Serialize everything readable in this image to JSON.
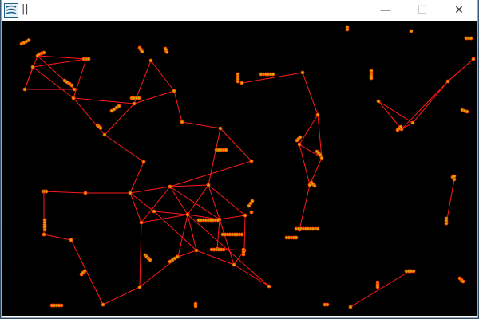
{
  "window": {
    "title": "||",
    "controls": {
      "minimize": "—",
      "maximize": "☐",
      "close": "✕"
    }
  },
  "colors": {
    "background": "#000000",
    "edge": "#ff1a1a",
    "node_fill": "#d4a800",
    "node_stroke": "#ff2a00",
    "titlebar": "#ffffff"
  },
  "icons": {
    "app": "app-logo-icon",
    "minimize": "minimize-icon",
    "maximize": "maximize-icon",
    "close": "close-icon"
  }
}
